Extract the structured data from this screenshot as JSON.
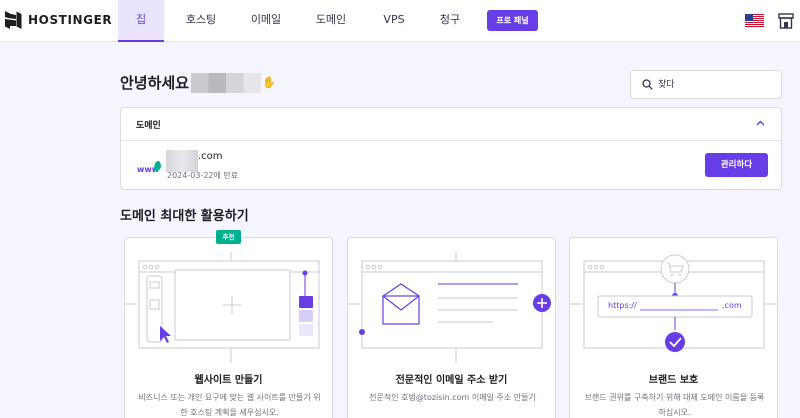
{
  "brand": {
    "name": "HOSTINGER"
  },
  "nav": {
    "items": [
      {
        "label": "집",
        "active": true
      },
      {
        "label": "호스팅",
        "active": false
      },
      {
        "label": "이메일",
        "active": false
      },
      {
        "label": "도메인",
        "active": false
      },
      {
        "label": "VPS",
        "active": false
      },
      {
        "label": "청구",
        "active": false
      }
    ],
    "panel_button": "프로 패널",
    "flag_icon": "us-flag-icon",
    "store_icon": "store-icon"
  },
  "greeting": {
    "text": "안녕하세요"
  },
  "search": {
    "placeholder": "찾다"
  },
  "domains": {
    "heading": "도메인",
    "item": {
      "name_suffix": ".com",
      "expiry": "2024-03-22에 만료",
      "manage_label": "관리하다"
    }
  },
  "section": {
    "title": "도메인 최대한 활용하기"
  },
  "features": [
    {
      "badge": "추천",
      "title": "웹사이트 만들기",
      "desc": "비즈니스 또는 개인 요구에 맞는 웹 사이트를 만들기 위한 호스팅 계획을 세우십시오."
    },
    {
      "title": "전문적인 이메일 주소 받기",
      "desc": "전문적인 호벙@tozisin.com 이메일 주소 만들기"
    },
    {
      "title": "브랜드 보호",
      "desc": "브랜드 권위를 구축하기 위해 대체 도메인 이름을 등록하십시오.",
      "url_prefix": "https://",
      "url_suffix": ".com"
    }
  ],
  "colors": {
    "accent": "#673de6",
    "background": "#f4f5ff",
    "badge": "#00b090"
  }
}
